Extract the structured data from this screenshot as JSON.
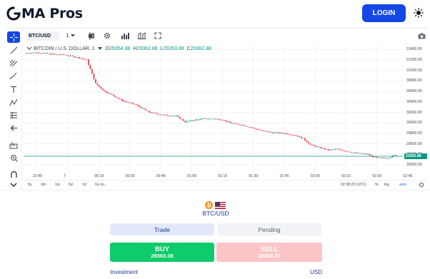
{
  "header": {
    "logo_text": "MA Pros",
    "login_label": "LOGIN",
    "theme_icon": "sun-icon"
  },
  "chart_toolbar": {
    "symbol": "BTC/USD",
    "interval": "1",
    "icons": [
      "interval-dropdown-icon",
      "candles-icon",
      "settings-icon",
      "indicators-icon",
      "compare-icon",
      "fullscreen-icon",
      "camera-icon"
    ]
  },
  "left_tools": [
    "crosshair-icon",
    "trendline-icon",
    "fib-icon",
    "brush-icon",
    "text-icon",
    "pattern-icon",
    "measure-icon",
    "back-arrow-icon",
    "ruler-icon",
    "zoom-icon",
    "magnet-icon",
    "more-icon"
  ],
  "legend": {
    "title": "BITCOIN / U.S. DOLLAR, 1",
    "open_label": "O",
    "open": "29354.38",
    "high_label": "H",
    "high": "29362.88",
    "low_label": "L",
    "low": "29353.88",
    "close_label": "C",
    "close": "29362.88"
  },
  "colors": {
    "up": "#089981",
    "down": "#f23645",
    "accent": "#1447e6",
    "buy": "#0ecb6b",
    "sell_disabled": "#fbc5c8"
  },
  "chart_data": {
    "type": "candlestick",
    "symbol": "BTC/USD",
    "ylim": [
      29050,
      31500
    ],
    "price_ticks": [
      "31400.00",
      "31200.00",
      "31000.00",
      "30800.00",
      "30600.00",
      "30400.00",
      "30200.00",
      "30000.00",
      "29800.00",
      "29600.00",
      "29400.00",
      "29200.00"
    ],
    "current_price": "29362.88",
    "time_ticks": [
      "23:45",
      "7",
      "00:15",
      "00:30",
      "00:45",
      "01:00",
      "01:15",
      "01:30",
      "01:45",
      "02:00",
      "02:15",
      "02:30",
      "02:45"
    ],
    "path_points": [
      [
        0,
        31330
      ],
      [
        8,
        31340
      ],
      [
        15,
        31310
      ],
      [
        22,
        31300
      ],
      [
        30,
        31250
      ],
      [
        35,
        31200
      ],
      [
        40,
        30750
      ],
      [
        45,
        30600
      ],
      [
        50,
        30520
      ],
      [
        55,
        30420
      ],
      [
        62,
        30350
      ],
      [
        70,
        30200
      ],
      [
        78,
        30150
      ],
      [
        85,
        30130
      ],
      [
        90,
        30020
      ],
      [
        96,
        30060
      ],
      [
        102,
        30080
      ],
      [
        110,
        30070
      ],
      [
        116,
        29990
      ],
      [
        122,
        29960
      ],
      [
        128,
        29900
      ],
      [
        134,
        29840
      ],
      [
        140,
        29810
      ],
      [
        146,
        29800
      ],
      [
        152,
        29760
      ],
      [
        156,
        29700
      ],
      [
        160,
        29580
      ],
      [
        165,
        29530
      ],
      [
        170,
        29480
      ],
      [
        175,
        29500
      ],
      [
        180,
        29460
      ],
      [
        186,
        29420
      ],
      [
        192,
        29400
      ],
      [
        197,
        29330
      ],
      [
        203,
        29330
      ],
      [
        207,
        29380
      ]
    ]
  },
  "time_axis_extra": {
    "ranges": [
      "5y",
      "3m",
      "1m",
      "5d",
      "1d",
      "Go to..."
    ],
    "clock": "02:38:23 (UTC)",
    "percent": "%",
    "log": "log",
    "auto": "auto"
  },
  "trade_panel": {
    "pair": "BTC/USD",
    "tab_trade": "Trade",
    "tab_pending": "Pending",
    "buy_label": "BUY",
    "buy_price": "29363.38",
    "sell_label": "SELL",
    "sell_price": "29362.37",
    "investment_label": "Investment",
    "currency": "USD"
  }
}
